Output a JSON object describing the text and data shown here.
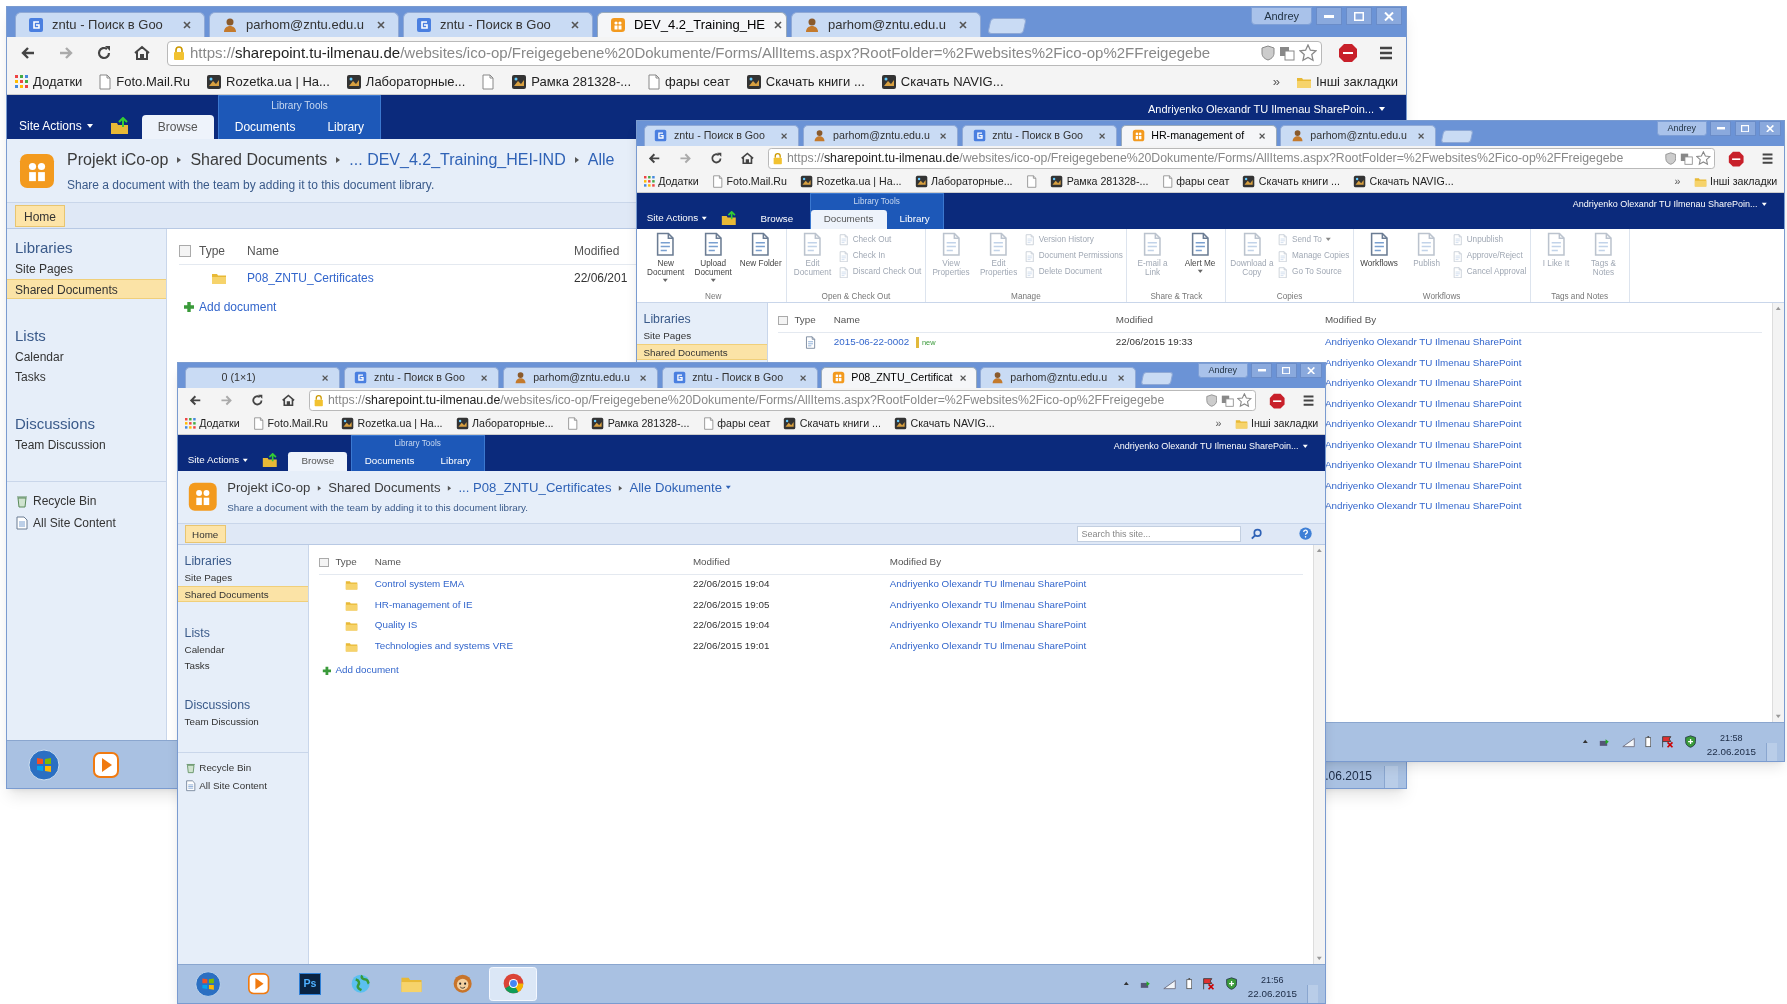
{
  "windows": [
    {
      "tabs": [
        {
          "kind": "search",
          "label": "zntu - Поиск в Goo",
          "selected": false
        },
        {
          "kind": "mail",
          "label": "parhom@zntu.edu.u",
          "selected": false
        },
        {
          "kind": "search",
          "label": "zntu - Поиск в Goo",
          "selected": false
        },
        {
          "kind": "site",
          "label": "DEV_4.2_Training_HE",
          "selected": true
        },
        {
          "kind": "mail",
          "label": "parhom@zntu.edu.u",
          "selected": false
        }
      ],
      "profile": "Andrey",
      "url": {
        "scheme": "https://",
        "host": "sharepoint.tu-ilmenau.de",
        "path": "/websites/ico-op/Freigegebene%20Dokumente/Forms/AllItems.aspx?RootFolder=%2Fwebsites%2Fico-op%2FFreigegebe"
      },
      "bookmarks": [
        {
          "kind": "apps",
          "label": "Додатки"
        },
        {
          "kind": "page",
          "label": "Foto.Mail.Ru"
        },
        {
          "kind": "image",
          "label": "Rozetka.ua | На..."
        },
        {
          "kind": "image",
          "label": "Лабораторные..."
        },
        {
          "kind": "page"
        },
        {
          "kind": "image",
          "label": "Рамка 281328-..."
        },
        {
          "kind": "page",
          "label": "фары сеат"
        },
        {
          "kind": "image",
          "label": "Скачать книги ..."
        },
        {
          "kind": "image",
          "label": "Скачать NAVIG..."
        }
      ],
      "bookmarks_more": "»",
      "other_bookmarks": "Інші закладки",
      "sharepoint": {
        "site_actions": "Site Actions",
        "tabs": [
          {
            "label": "Browse",
            "selected": true
          }
        ],
        "tools": {
          "label": "Library Tools",
          "tabs": [
            {
              "label": "Documents",
              "selected": false
            },
            {
              "label": "Library",
              "selected": false
            }
          ]
        },
        "user": "Andriyenko Olexandr TU Ilmenau SharePoin..."
      },
      "page_header": {
        "breadcrumb": [
          {
            "label": "Projekt iCo-op",
            "link": false
          },
          {
            "label": "Shared Documents",
            "link": false
          },
          {
            "label": "... DEV_4.2_Training_HEI-IND",
            "link": true
          },
          {
            "label": "Alle",
            "link": true
          }
        ],
        "description": "Share a document with the team by adding it to this document library."
      },
      "home_bar": {
        "home": {
          "label": "Home",
          "selected": true
        }
      },
      "nav": {
        "sections": [
          {
            "heading": "Libraries",
            "items": [
              {
                "label": "Site Pages",
                "selected": false
              },
              {
                "label": "Shared Documents",
                "selected": true
              }
            ]
          },
          {
            "heading": "Lists",
            "items": [
              {
                "label": "Calendar",
                "selected": false
              },
              {
                "label": "Tasks",
                "selected": false
              }
            ]
          },
          {
            "heading": "Discussions",
            "items": [
              {
                "label": "Team Discussion",
                "selected": false
              }
            ]
          }
        ],
        "footer": [
          {
            "kind": "recycle",
            "label": "Recycle Bin"
          },
          {
            "kind": "content",
            "label": "All Site Content"
          }
        ]
      },
      "list": {
        "select_all_checked": false,
        "columns": [
          "Type",
          "Name",
          "Modified"
        ],
        "rows": [
          {
            "kind": "folder",
            "name": "P08_ZNTU_Certificates",
            "modified": "22/06/201"
          }
        ],
        "add": "Add document"
      },
      "taskbar": {
        "apps": [
          {
            "kind": "start",
            "selected": false
          },
          {
            "kind": "media",
            "selected": false
          }
        ],
        "clock": {
          "date": ".06.2015"
        }
      }
    },
    {
      "tabs": [
        {
          "kind": "search",
          "label": "zntu - Поиск в Goo",
          "selected": false
        },
        {
          "kind": "mail",
          "label": "parhom@zntu.edu.u",
          "selected": false
        },
        {
          "kind": "search",
          "label": "zntu - Поиск в Goo",
          "selected": false
        },
        {
          "kind": "site",
          "label": "HR-management of",
          "selected": true
        },
        {
          "kind": "mail",
          "label": "parhom@zntu.edu.u",
          "selected": false
        }
      ],
      "profile": "Andrey",
      "url": {
        "scheme": "https://",
        "host": "sharepoint.tu-ilmenau.de",
        "path": "/websites/ico-op/Freigegebene%20Dokumente/Forms/AllItems.aspx?RootFolder=%2Fwebsites%2Fico-op%2FFreigegebe"
      },
      "bookmarks": [
        {
          "kind": "apps",
          "label": "Додатки"
        },
        {
          "kind": "page",
          "label": "Foto.Mail.Ru"
        },
        {
          "kind": "image",
          "label": "Rozetka.ua | На..."
        },
        {
          "kind": "image",
          "label": "Лабораторные..."
        },
        {
          "kind": "page"
        },
        {
          "kind": "image",
          "label": "Рамка 281328-..."
        },
        {
          "kind": "page",
          "label": "фары сеат"
        },
        {
          "kind": "image",
          "label": "Скачать книги ..."
        },
        {
          "kind": "image",
          "label": "Скачать NAVIG..."
        }
      ],
      "bookmarks_more": "»",
      "other_bookmarks": "Інші закладки",
      "sharepoint": {
        "site_actions": "Site Actions",
        "tabs": [
          {
            "label": "Browse",
            "selected": false
          }
        ],
        "tools": {
          "label": "Library Tools",
          "tabs": [
            {
              "label": "Documents",
              "selected": true
            },
            {
              "label": "Library",
              "selected": false
            }
          ]
        },
        "user": "Andriyenko Olexandr TU Ilmenau SharePoin..."
      },
      "ribbon": {
        "groups": [
          {
            "label": "New",
            "items": [
              {
                "kind": "large",
                "label": "New Document",
                "dropdown": true,
                "disabled": false
              },
              {
                "kind": "large",
                "label": "Upload Document",
                "dropdown": true,
                "disabled": false
              },
              {
                "kind": "large",
                "label": "New Folder",
                "disabled": false
              }
            ]
          },
          {
            "label": "Open & Check Out",
            "items": [
              {
                "kind": "large",
                "label": "Edit Document",
                "disabled": true
              },
              {
                "kind": "small",
                "label": "Check Out",
                "disabled": true
              },
              {
                "kind": "small",
                "label": "Check In",
                "disabled": true
              },
              {
                "kind": "small",
                "label": "Discard Check Out",
                "disabled": true
              }
            ]
          },
          {
            "label": "Manage",
            "items": [
              {
                "kind": "large",
                "label": "View Properties",
                "disabled": true
              },
              {
                "kind": "large",
                "label": "Edit Properties",
                "disabled": true
              },
              {
                "kind": "small",
                "label": "Version History",
                "disabled": true
              },
              {
                "kind": "small",
                "label": "Document Permissions",
                "disabled": true
              },
              {
                "kind": "small",
                "label": "Delete Document",
                "disabled": true
              }
            ]
          },
          {
            "label": "Share & Track",
            "items": [
              {
                "kind": "large",
                "label": "E-mail a Link",
                "disabled": true
              },
              {
                "kind": "large",
                "label": "Alert Me",
                "dropdown": true,
                "disabled": false
              }
            ]
          },
          {
            "label": "Copies",
            "items": [
              {
                "kind": "large",
                "label": "Download a Copy",
                "disabled": true
              },
              {
                "kind": "small",
                "label": "Send To",
                "dropdown": true,
                "disabled": true
              },
              {
                "kind": "small",
                "label": "Manage Copies",
                "disabled": true
              },
              {
                "kind": "small",
                "label": "Go To Source",
                "disabled": true
              }
            ]
          },
          {
            "label": "Workflows",
            "items": [
              {
                "kind": "large",
                "label": "Workflows",
                "disabled": false
              },
              {
                "kind": "large",
                "label": "Publish",
                "disabled": true
              },
              {
                "kind": "small",
                "label": "Unpublish",
                "disabled": true
              },
              {
                "kind": "small",
                "label": "Approve/Reject",
                "disabled": true
              },
              {
                "kind": "small",
                "label": "Cancel Approval",
                "disabled": true
              }
            ]
          },
          {
            "label": "Tags and Notes",
            "items": [
              {
                "kind": "large",
                "label": "I Like It",
                "disabled": true
              },
              {
                "kind": "large",
                "label": "Tags & Notes",
                "disabled": true
              }
            ]
          }
        ]
      },
      "nav": {
        "sections": [
          {
            "heading": "Libraries",
            "items": [
              {
                "label": "Site Pages",
                "selected": false
              },
              {
                "label": "Shared Documents",
                "selected": true
              }
            ]
          }
        ]
      },
      "list": {
        "select_all_checked": false,
        "columns": [
          "Type",
          "Name",
          "Modified",
          "Modified By"
        ],
        "rows": [
          {
            "kind": "document",
            "name": "2015-06-22-0002",
            "badge": "new",
            "modified": "22/06/2015 19:33",
            "modified_by": "Andriyenko Olexandr TU Ilmenau SharePoint"
          },
          {
            "modified_by": "Andriyenko Olexandr TU Ilmenau SharePoint"
          },
          {
            "modified_by": "Andriyenko Olexandr TU Ilmenau SharePoint"
          },
          {
            "modified_by": "Andriyenko Olexandr TU Ilmenau SharePoint"
          },
          {
            "modified_by": "Andriyenko Olexandr TU Ilmenau SharePoint"
          },
          {
            "modified_by": "Andriyenko Olexandr TU Ilmenau SharePoint"
          },
          {
            "modified_by": "Andriyenko Olexandr TU Ilmenau SharePoint"
          },
          {
            "modified_by": "Andriyenko Olexandr TU Ilmenau SharePoint"
          },
          {
            "modified_by": "Andriyenko Olexandr TU Ilmenau SharePoint"
          }
        ]
      },
      "scrollbar": true,
      "taskbar": {
        "tray": true,
        "clock": {
          "time": "21:58",
          "date": "22.06.2015"
        }
      }
    },
    {
      "tabs": [
        {
          "kind": "counter",
          "label": "0 (1×1)",
          "selected": false
        },
        {
          "kind": "search",
          "label": "zntu - Поиск в Goo",
          "selected": false
        },
        {
          "kind": "mail",
          "label": "parhom@zntu.edu.u",
          "selected": false
        },
        {
          "kind": "search",
          "label": "zntu - Поиск в Goo",
          "selected": false
        },
        {
          "kind": "site",
          "label": "P08_ZNTU_Certificat",
          "selected": true
        },
        {
          "kind": "mail",
          "label": "parhom@zntu.edu.u",
          "selected": false
        }
      ],
      "profile": "Andrey",
      "url": {
        "scheme": "https://",
        "host": "sharepoint.tu-ilmenau.de",
        "path": "/websites/ico-op/Freigegebene%20Dokumente/Forms/AllItems.aspx?RootFolder=%2Fwebsites%2Fico-op%2FFreigegebe"
      },
      "bookmarks": [
        {
          "kind": "apps",
          "label": "Додатки"
        },
        {
          "kind": "page",
          "label": "Foto.Mail.Ru"
        },
        {
          "kind": "image",
          "label": "Rozetka.ua | На..."
        },
        {
          "kind": "image",
          "label": "Лабораторные..."
        },
        {
          "kind": "page"
        },
        {
          "kind": "image",
          "label": "Рамка 281328-..."
        },
        {
          "kind": "page",
          "label": "фары сеат"
        },
        {
          "kind": "image",
          "label": "Скачать книги ..."
        },
        {
          "kind": "image",
          "label": "Скачать NAVIG..."
        }
      ],
      "bookmarks_more": "»",
      "other_bookmarks": "Інші закладки",
      "sharepoint": {
        "site_actions": "Site Actions",
        "tabs": [
          {
            "label": "Browse",
            "selected": true
          }
        ],
        "tools": {
          "label": "Library Tools",
          "tabs": [
            {
              "label": "Documents",
              "selected": false
            },
            {
              "label": "Library",
              "selected": false
            }
          ]
        },
        "user": "Andriyenko Olexandr TU Ilmenau SharePoin..."
      },
      "page_header": {
        "breadcrumb": [
          {
            "label": "Projekt iCo-op",
            "link": false
          },
          {
            "label": "Shared Documents",
            "link": false
          },
          {
            "label": "... P08_ZNTU_Certificates",
            "link": true
          },
          {
            "label": "Alle Dokumente",
            "link": true,
            "menu": true
          }
        ],
        "description": "Share a document with the team by adding it to this document library."
      },
      "home_bar": {
        "home": {
          "label": "Home",
          "selected": true
        },
        "search": {
          "placeholder": "Search this site..."
        }
      },
      "nav": {
        "sections": [
          {
            "heading": "Libraries",
            "items": [
              {
                "label": "Site Pages",
                "selected": false
              },
              {
                "label": "Shared Documents",
                "selected": true
              }
            ]
          },
          {
            "heading": "Lists",
            "items": [
              {
                "label": "Calendar",
                "selected": false
              },
              {
                "label": "Tasks",
                "selected": false
              }
            ]
          },
          {
            "heading": "Discussions",
            "items": [
              {
                "label": "Team Discussion",
                "selected": false
              }
            ]
          }
        ],
        "footer": [
          {
            "kind": "recycle",
            "label": "Recycle Bin"
          },
          {
            "kind": "content",
            "label": "All Site Content"
          }
        ]
      },
      "list": {
        "select_all_checked": false,
        "columns": [
          "Type",
          "Name",
          "Modified",
          "Modified By"
        ],
        "rows": [
          {
            "kind": "folder",
            "name": "Control system EMA",
            "modified": "22/06/2015 19:04",
            "modified_by": "Andriyenko Olexandr TU Ilmenau SharePoint"
          },
          {
            "kind": "folder",
            "name": "HR-management of IE",
            "modified": "22/06/2015 19:05",
            "modified_by": "Andriyenko Olexandr TU Ilmenau SharePoint"
          },
          {
            "kind": "folder",
            "name": "Quality IS",
            "modified": "22/06/2015 19:04",
            "modified_by": "Andriyenko Olexandr TU Ilmenau SharePoint"
          },
          {
            "kind": "folder",
            "name": "Technologies and systems VRE",
            "modified": "22/06/2015 19:01",
            "modified_by": "Andriyenko Olexandr TU Ilmenau SharePoint"
          }
        ],
        "add": "Add document"
      },
      "scrollbar": true,
      "taskbar": {
        "apps": [
          {
            "kind": "start",
            "selected": false
          },
          {
            "kind": "media",
            "selected": false
          },
          {
            "kind": "tile",
            "label": "Ps",
            "selected": false
          },
          {
            "kind": "globe",
            "selected": false
          },
          {
            "kind": "folder",
            "selected": false
          },
          {
            "kind": "face",
            "selected": false
          },
          {
            "kind": "browser",
            "selected": true
          }
        ],
        "tray": true,
        "clock": {
          "time": "21:56",
          "date": "22.06.2015"
        }
      }
    }
  ]
}
